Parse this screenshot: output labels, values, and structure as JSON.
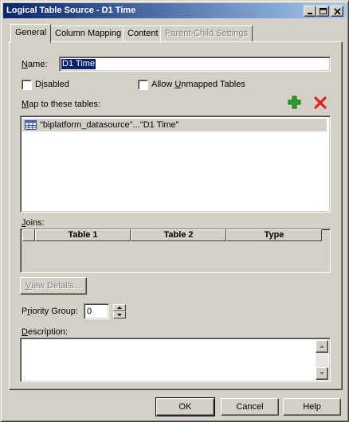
{
  "window": {
    "title": "Logical Table Source - D1 Time"
  },
  "tabs": [
    {
      "label": "General",
      "active": true
    },
    {
      "label": "Column Mapping"
    },
    {
      "label": "Content"
    },
    {
      "label": "Parent-Child Settings",
      "disabled": true
    }
  ],
  "general": {
    "name_label_pre": "",
    "name_label_u": "N",
    "name_label_post": "ame:",
    "name_value": "D1 Time",
    "disabled_label_pre": "D",
    "disabled_label_u": "i",
    "disabled_label_post": "sabled",
    "allow_label_pre": "Allow ",
    "allow_label_u": "U",
    "allow_label_post": "nmapped Tables",
    "map_label_u": "M",
    "map_label_post": "ap to these tables:",
    "mapped_tables": [
      "\"biplatform_datasource\"...\"D1 Time\""
    ],
    "joins_label_u": "J",
    "joins_label_post": "oins:",
    "joins_columns": [
      "Table 1",
      "Table 2",
      "Type"
    ],
    "view_details_pre": "",
    "view_details_u": "V",
    "view_details_post": "iew Details...",
    "priority_label_pre": "P",
    "priority_label_u": "r",
    "priority_label_post": "iority Group:",
    "priority_value": "0",
    "description_label_u": "D",
    "description_label_post": "escription:",
    "description_value": ""
  },
  "buttons": {
    "ok": "OK",
    "cancel": "Cancel",
    "help": "Help"
  },
  "colors": {
    "titlebar_start": "#0a246a",
    "titlebar_end": "#a6caf0",
    "add_icon": "#2aa02a",
    "delete_icon": "#e02020"
  },
  "icons": {
    "add": "plus-icon",
    "delete": "x-icon",
    "table": "table-icon"
  }
}
